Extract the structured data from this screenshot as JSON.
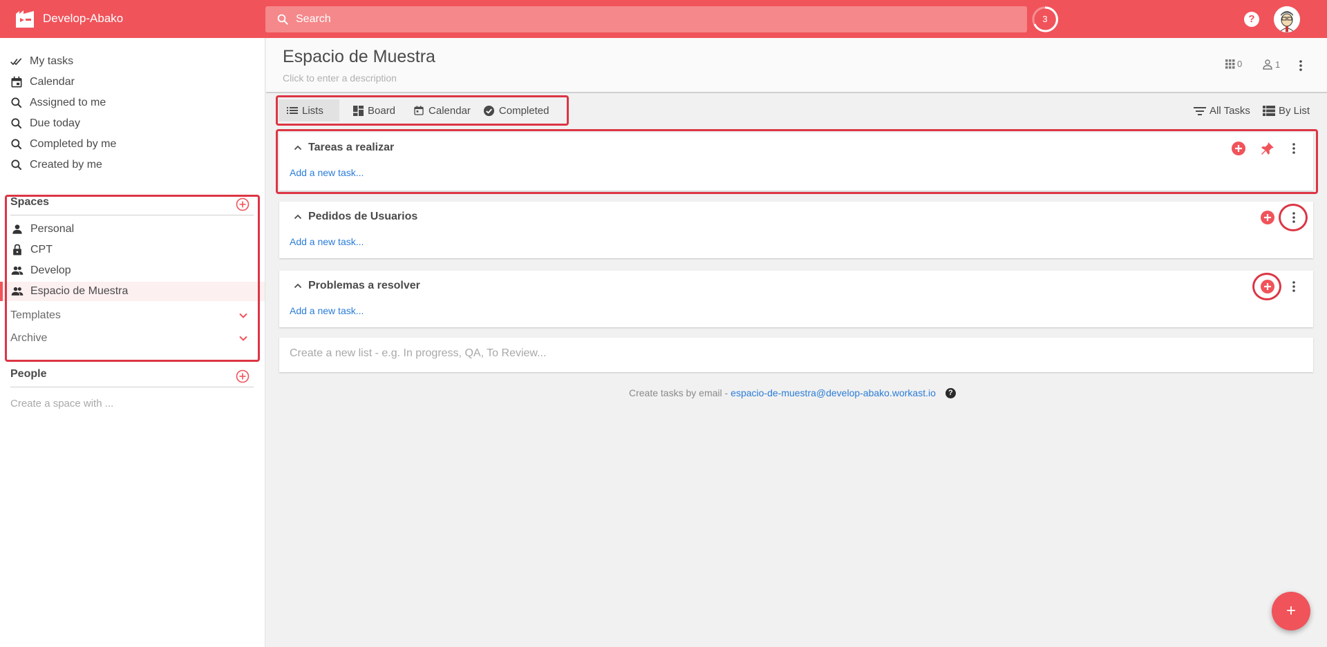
{
  "app": {
    "title": "Develop-Abako",
    "brand_color": "#f0535a"
  },
  "search": {
    "placeholder": "Search"
  },
  "notifications": {
    "count": "3"
  },
  "help": {
    "label": "?"
  },
  "sidebar": {
    "nav": [
      {
        "label": "My tasks",
        "icon": "double-check-icon"
      },
      {
        "label": "Calendar",
        "icon": "calendar-icon"
      },
      {
        "label": "Assigned to me",
        "icon": "search-icon"
      },
      {
        "label": "Due today",
        "icon": "search-icon"
      },
      {
        "label": "Completed by me",
        "icon": "search-icon"
      },
      {
        "label": "Created by me",
        "icon": "search-icon"
      }
    ],
    "spaces_heading": "Spaces",
    "spaces": [
      {
        "label": "Personal",
        "icon": "person-icon"
      },
      {
        "label": "CPT",
        "icon": "lock-icon"
      },
      {
        "label": "Develop",
        "icon": "people-icon"
      },
      {
        "label": "Espacio de Muestra",
        "icon": "people-icon",
        "active": true
      }
    ],
    "templates_label": "Templates",
    "archive_label": "Archive",
    "people_heading": "People",
    "people_hint": "Create a space with ..."
  },
  "header": {
    "title": "Espacio de Muestra",
    "description_placeholder": "Click to enter a description",
    "apps_count": "0",
    "members_count": "1"
  },
  "view_tabs": [
    {
      "label": "Lists",
      "icon": "list-icon",
      "active": true
    },
    {
      "label": "Board",
      "icon": "board-icon"
    },
    {
      "label": "Calendar",
      "icon": "calendar-icon"
    },
    {
      "label": "Completed",
      "icon": "check-circle-icon"
    }
  ],
  "tools": {
    "filter_label": "All Tasks",
    "group_label": "By List"
  },
  "lists": [
    {
      "title": "Tareas a realizar",
      "add_task": "Add a new task..."
    },
    {
      "title": "Pedidos de Usuarios",
      "add_task": "Add a new task..."
    },
    {
      "title": "Problemas a resolver",
      "add_task": "Add a new task..."
    }
  ],
  "new_list": {
    "placeholder": "Create a new list - e.g. In progress, QA, To Review..."
  },
  "email": {
    "prefix": "Create tasks by email -",
    "address": "espacio-de-muestra@develop-abako.workast.io",
    "help": "?"
  },
  "fab": {
    "label": "+"
  }
}
